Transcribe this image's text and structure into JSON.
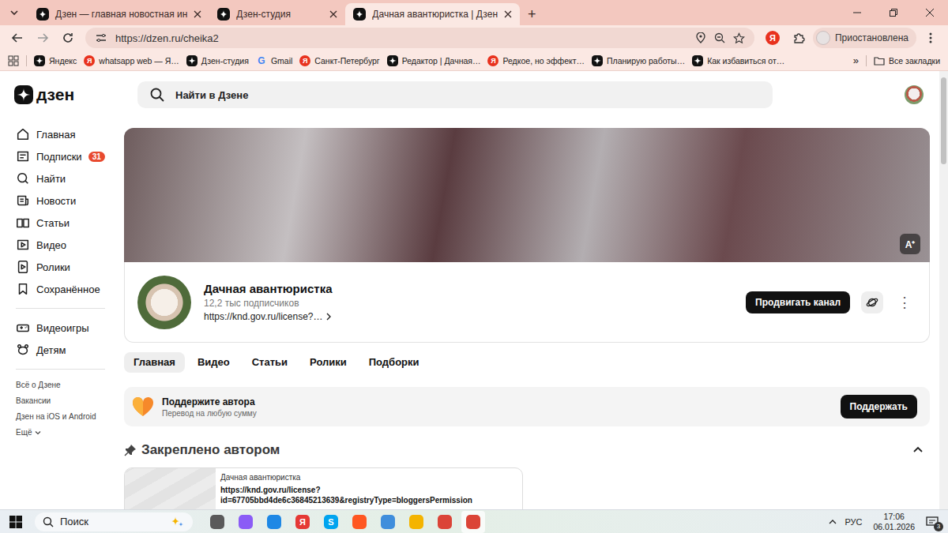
{
  "browser": {
    "tabs": [
      {
        "title": "Дзен — главная новостная ин",
        "selected": false
      },
      {
        "title": "Дзен-студия",
        "selected": false
      },
      {
        "title": "Дачная авантюристка | Дзен",
        "selected": true
      }
    ],
    "new_tab": "+",
    "address": "https://dzen.ru/cheika2",
    "extension_glyph": "Я",
    "profile": "Приостановлена",
    "bookmarks": [
      {
        "label": "Яндекс",
        "kind": "dzen"
      },
      {
        "label": "whatsapp web — Я…",
        "kind": "yandex",
        "glyph": "Я"
      },
      {
        "label": "Дзен-студия",
        "kind": "dzen"
      },
      {
        "label": "Gmail",
        "kind": "gmail",
        "glyph": "G"
      },
      {
        "label": "Санкт-Петербург",
        "kind": "yandex",
        "glyph": "Я"
      },
      {
        "label": "Редактор | Дачная…",
        "kind": "dzen"
      },
      {
        "label": "Редкое, но эффект…",
        "kind": "yandex",
        "glyph": "Я"
      },
      {
        "label": "Планирую работы…",
        "kind": "dzen"
      },
      {
        "label": "Как избавиться от…",
        "kind": "dzen"
      }
    ],
    "bookmarks_more": "»",
    "all_bookmarks": "Все закладки"
  },
  "header": {
    "logo": "дзен",
    "search_placeholder": "Найти в Дзене"
  },
  "sidebar": {
    "items": [
      {
        "label": "Главная"
      },
      {
        "label": "Подписки",
        "badge": "31"
      },
      {
        "label": "Найти"
      },
      {
        "label": "Новости"
      },
      {
        "label": "Статьи"
      },
      {
        "label": "Видео"
      },
      {
        "label": "Ролики"
      },
      {
        "label": "Сохранённое"
      }
    ],
    "extra": [
      {
        "label": "Видеоигры"
      },
      {
        "label": "Детям"
      }
    ],
    "links": [
      "Всё о Дзене",
      "Вакансии",
      "Дзен на iOS и Android",
      "Ещё"
    ]
  },
  "channel": {
    "banner_button": "A⁺",
    "name": "Дачная авантюристка",
    "subscribers": "12,2 тыс подписчиков",
    "link": "https://knd.gov.ru/license?…",
    "promote": "Продвигать канал",
    "more": "⋮"
  },
  "channel_tabs": [
    {
      "label": "Главная",
      "selected": true
    },
    {
      "label": "Видео",
      "selected": false
    },
    {
      "label": "Статьи",
      "selected": false
    },
    {
      "label": "Ролики",
      "selected": false
    },
    {
      "label": "Подборки",
      "selected": false
    }
  ],
  "support": {
    "title": "Поддержите автора",
    "subtitle": "Перевод на любую сумму",
    "button": "Поддержать"
  },
  "pinned": {
    "title": "Закреплено автором",
    "expanded": true,
    "card": {
      "author": "Дачная авантюристка",
      "text": "https://knd.gov.ru/license?id=67705bbd4de6c36845213639&registryType=bloggersPermission"
    }
  },
  "taskbar": {
    "search": "Поиск",
    "apps": [
      {
        "color": "#5a5a5a",
        "active": false
      },
      {
        "color": "#8b5cf6",
        "active": false
      },
      {
        "color": "#1e88e5",
        "active": false
      },
      {
        "color": "#e53935",
        "glyph": "Я",
        "active": false
      },
      {
        "color": "#00a4ef",
        "glyph": "S",
        "active": false
      },
      {
        "color": "#ff5722",
        "active": false
      },
      {
        "color": "#3f8edc",
        "active": false
      },
      {
        "color": "#f4b400",
        "active": false
      },
      {
        "color": "#db4437",
        "active": false
      },
      {
        "color": "#db4437",
        "active": true
      }
    ],
    "language": "РУС",
    "time": "17:06",
    "date": "06.01.2026",
    "notifications": "3"
  }
}
